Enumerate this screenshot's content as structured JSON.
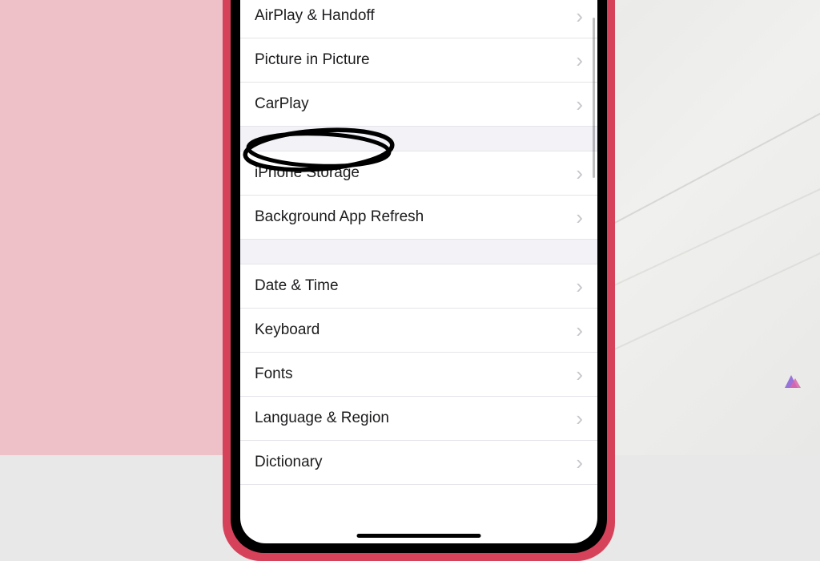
{
  "settings": {
    "group1": {
      "items": [
        {
          "label": "AirPlay & Handoff"
        },
        {
          "label": "Picture in Picture"
        },
        {
          "label": "CarPlay"
        }
      ]
    },
    "group2": {
      "items": [
        {
          "label": "iPhone Storage"
        },
        {
          "label": "Background App Refresh"
        }
      ]
    },
    "group3": {
      "items": [
        {
          "label": "Date & Time"
        },
        {
          "label": "Keyboard"
        },
        {
          "label": "Fonts"
        },
        {
          "label": "Language & Region"
        },
        {
          "label": "Dictionary"
        }
      ]
    }
  }
}
